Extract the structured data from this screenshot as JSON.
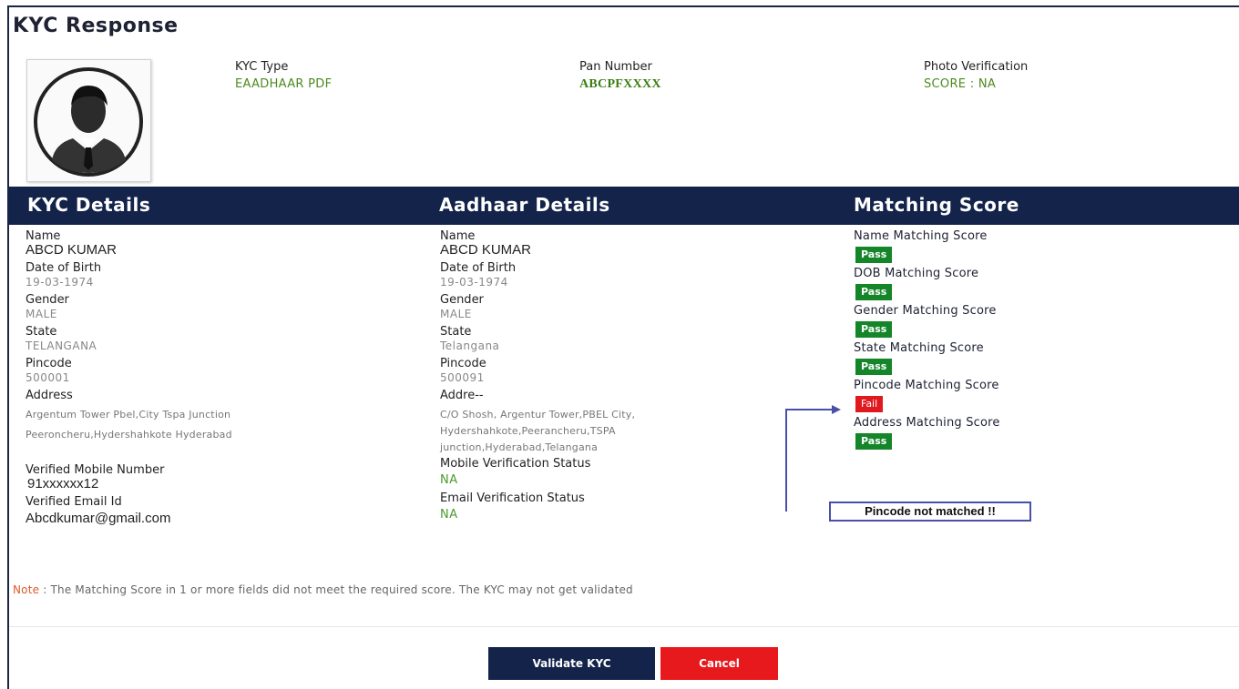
{
  "page": {
    "title": "KYC Response"
  },
  "meta": {
    "kyc_type": {
      "label": "KYC Type",
      "value": "EAADHAAR PDF"
    },
    "pan_number": {
      "label": "Pan Number",
      "value": "ABCPFXXXX"
    },
    "photo_verification": {
      "label": "Photo Verification",
      "value": "SCORE : NA"
    }
  },
  "headers": {
    "kyc_details": "KYC Details",
    "aadhaar_details": "Aadhaar Details",
    "matching_score": "Matching Score"
  },
  "kyc_details": {
    "name_label": "Name",
    "name": "ABCD KUMAR",
    "dob_label": "Date of Birth",
    "dob": "19-03-1974",
    "gender_label": "Gender",
    "gender": "MALE",
    "state_label": "State",
    "state": "TELANGANA",
    "pincode_label": "Pincode",
    "pincode": "500001",
    "address_label": "Address",
    "address_line1": "Argentum Tower Pbel,City Tspa Junction",
    "address_line2": "Peeroncheru,Hydershahkote Hyderabad",
    "mobile_label": "Verified Mobile Number",
    "mobile": "91xxxxxx12",
    "email_label": "Verified Email Id",
    "email": "Abcdkumar@gmail.com"
  },
  "aadhaar_details": {
    "name_label": "Name",
    "name": "ABCD KUMAR",
    "dob_label": "Date of Birth",
    "dob": "19-03-1974",
    "gender_label": "Gender",
    "gender": "MALE",
    "state_label": "State",
    "state": "Telangana",
    "pincode_label": "Pincode",
    "pincode": "500091",
    "address_label": "Addre--",
    "address_line1": "C/O Shosh, Argentur Tower,PBEL City,",
    "address_line2": "Hydershahkote,Peerancheru,TSPA",
    "address_line3": "junction,Hyderabad,Telangana",
    "mobile_status_label": "Mobile Verification Status",
    "mobile_status": "NA",
    "email_status_label": "Email Verification Status",
    "email_status": "NA"
  },
  "matching_scores": [
    {
      "label": "Name Matching Score",
      "result": "Pass",
      "status": "pass"
    },
    {
      "label": "DOB Matching Score",
      "result": "Pass",
      "status": "pass"
    },
    {
      "label": "Gender Matching Score",
      "result": "Pass",
      "status": "pass"
    },
    {
      "label": "State Matching Score",
      "result": "Pass",
      "status": "pass"
    },
    {
      "label": "Pincode Matching Score",
      "result": "Fail",
      "status": "fail"
    },
    {
      "label": "Address Matching Score",
      "result": "Pass",
      "status": "pass"
    }
  ],
  "callout": {
    "text": "Pincode not matched !!"
  },
  "note": {
    "prefix": "Note",
    "text": " : The Matching Score in 1 or more fields did not meet the required score. The KYC may not get validated"
  },
  "buttons": {
    "validate": "Validate KYC",
    "cancel": "Cancel"
  },
  "colors": {
    "header_bg": "#13234a",
    "pass": "#15852a",
    "fail": "#e0191e",
    "value_green": "#4b8b1e",
    "cancel": "#e8191c"
  }
}
